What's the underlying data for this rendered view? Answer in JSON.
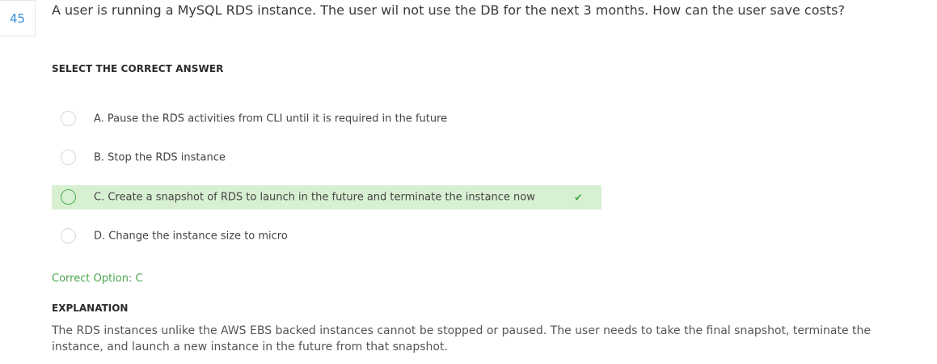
{
  "question": {
    "number": "45",
    "text": "A user is running a MySQL RDS instance. The user wil not use the DB for the next 3 months. How can the user save costs?"
  },
  "select_heading": "SELECT THE CORRECT ANSWER",
  "options": [
    {
      "text": "A. Pause the RDS activities from CLI until it is required in the future",
      "correct": false
    },
    {
      "text": "B. Stop the RDS instance",
      "correct": false
    },
    {
      "text": "C. Create a snapshot of RDS to launch in the future and terminate the instance now",
      "correct": true
    },
    {
      "text": "D. Change the instance size to micro",
      "correct": false
    }
  ],
  "check_mark": "✔",
  "correct_option_text": "Correct Option: C",
  "explanation_heading": "EXPLANATION",
  "explanation_text": "The RDS instances unlike the AWS EBS backed instances cannot be stopped or paused. The user needs to take the final snapshot, terminate the instance, and launch a new instance in the future from that snapshot.",
  "colors": {
    "accent_blue": "#3d8fd6",
    "correct_green": "#4caf50",
    "correct_bg": "#d8f0d2"
  }
}
